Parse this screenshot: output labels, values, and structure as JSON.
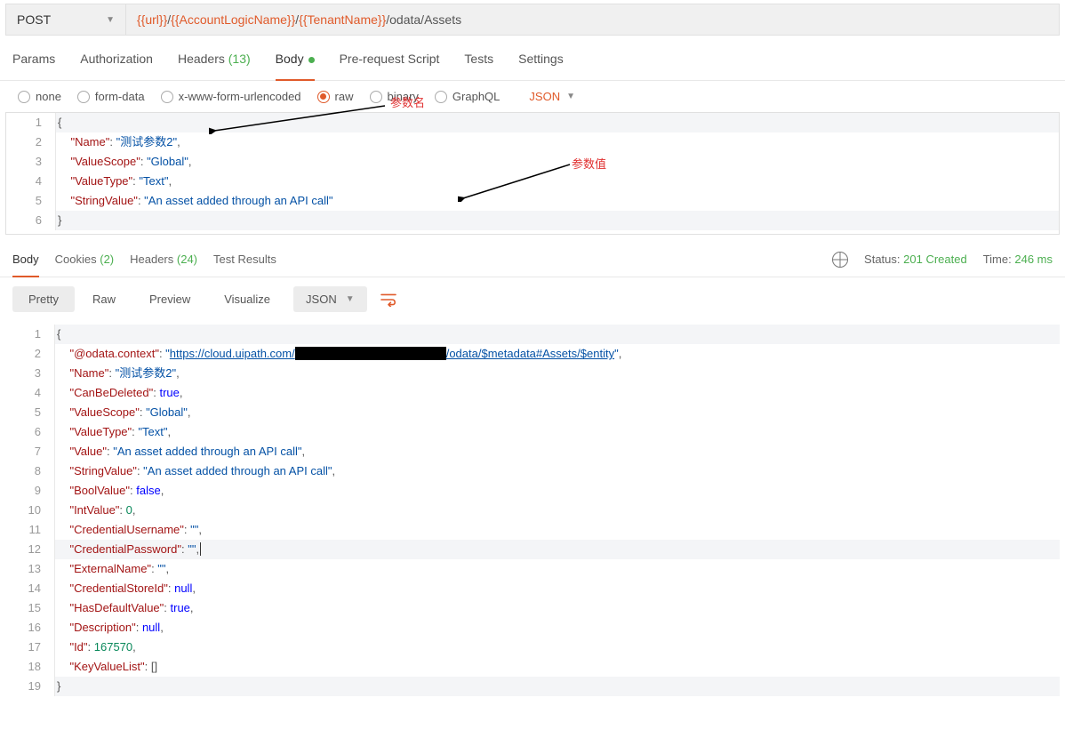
{
  "request": {
    "method": "POST",
    "url_parts": {
      "v1": "{{url}}",
      "s1": "/",
      "v2": "{{AccountLogicName}}",
      "s2": "/",
      "v3": "{{TenantName}}",
      "s3": "/odata/Assets"
    }
  },
  "tabs": {
    "params": "Params",
    "auth": "Authorization",
    "headers": "Headers",
    "headers_count": "(13)",
    "body": "Body",
    "prerequest": "Pre-request Script",
    "tests": "Tests",
    "settings": "Settings"
  },
  "body_types": {
    "none": "none",
    "formdata": "form-data",
    "xwww": "x-www-form-urlencoded",
    "raw": "raw",
    "binary": "binary",
    "graphql": "GraphQL",
    "fmt": "JSON"
  },
  "req_body": {
    "name_k": "\"Name\"",
    "name_v": "\"测试参数2\"",
    "vs_k": "\"ValueScope\"",
    "vs_v": "\"Global\"",
    "vt_k": "\"ValueType\"",
    "vt_v": "\"Text\"",
    "sv_k": "\"StringValue\"",
    "sv_v": "\"An asset added through an API call\""
  },
  "annotations": {
    "param_name": "参数名",
    "param_value": "参数值"
  },
  "resp_tabs": {
    "body": "Body",
    "cookies": "Cookies",
    "cookies_count": "(2)",
    "headers": "Headers",
    "headers_count": "(24)",
    "testres": "Test Results"
  },
  "resp_meta": {
    "status_label": "Status:",
    "status_val": "201 Created",
    "time_label": "Time:",
    "time_val": "246 ms"
  },
  "view_bar": {
    "pretty": "Pretty",
    "raw": "Raw",
    "preview": "Preview",
    "visualize": "Visualize",
    "json": "JSON"
  },
  "resp_body": {
    "ctx_k": "\"@odata.context\"",
    "ctx_pre": "\"",
    "ctx_url_a": "https://cloud.uipath.com/",
    "ctx_url_b": "/odata/$metadata#Assets/$entity",
    "ctx_post": "\"",
    "name_k": "\"Name\"",
    "name_v": "\"测试参数2\"",
    "cbd_k": "\"CanBeDeleted\"",
    "cbd_v": "true",
    "vs_k": "\"ValueScope\"",
    "vs_v": "\"Global\"",
    "vt_k": "\"ValueType\"",
    "vt_v": "\"Text\"",
    "val_k": "\"Value\"",
    "val_v": "\"An asset added through an API call\"",
    "sv_k": "\"StringValue\"",
    "sv_v": "\"An asset added through an API call\"",
    "bv_k": "\"BoolValue\"",
    "bv_v": "false",
    "iv_k": "\"IntValue\"",
    "iv_v": "0",
    "cu_k": "\"CredentialUsername\"",
    "cu_v": "\"\"",
    "cp_k": "\"CredentialPassword\"",
    "cp_v": "\"\"",
    "en_k": "\"ExternalName\"",
    "en_v": "\"\"",
    "csi_k": "\"CredentialStoreId\"",
    "csi_v": "null",
    "hdv_k": "\"HasDefaultValue\"",
    "hdv_v": "true",
    "desc_k": "\"Description\"",
    "desc_v": "null",
    "id_k": "\"Id\"",
    "id_v": "167570",
    "kvl_k": "\"KeyValueList\"",
    "kvl_v": "[]"
  },
  "lines": {
    "l1": "1",
    "l2": "2",
    "l3": "3",
    "l4": "4",
    "l5": "5",
    "l6": "6",
    "l7": "7",
    "l8": "8",
    "l9": "9",
    "l10": "10",
    "l11": "11",
    "l12": "12",
    "l13": "13",
    "l14": "14",
    "l15": "15",
    "l16": "16",
    "l17": "17",
    "l18": "18",
    "l19": "19"
  }
}
